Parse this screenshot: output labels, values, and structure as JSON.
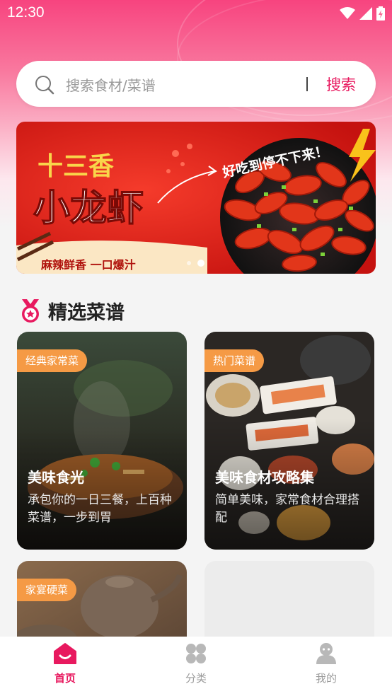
{
  "status_bar": {
    "time": "12:30"
  },
  "search": {
    "placeholder": "搜索食材/菜谱",
    "button_label": "搜索"
  },
  "banner": {
    "title_line1": "十三香",
    "title_line2": "小龙虾",
    "slogan": "好吃到停不下来！",
    "subtitle": "麻辣鲜香 一口爆汁",
    "active_dot": 2,
    "dot_count": 2
  },
  "section": {
    "title": "精选菜谱"
  },
  "cards": [
    {
      "tag": "经典家常菜",
      "title": "美味食光",
      "desc": "承包你的一日三餐，上百种菜谱，一步到胃"
    },
    {
      "tag": "热门菜谱",
      "title": "美味食材攻略集",
      "desc": "简单美味，家常食材合理搭配"
    },
    {
      "tag": "家宴硬菜",
      "title": "",
      "desc": ""
    }
  ],
  "nav": [
    {
      "label": "首页",
      "icon": "home-icon",
      "active": true
    },
    {
      "label": "分类",
      "icon": "category-icon",
      "active": false
    },
    {
      "label": "我的",
      "icon": "profile-icon",
      "active": false
    }
  ],
  "colors": {
    "accent": "#e8195f",
    "tag": "#f59a45",
    "inactive": "#9b9b9b"
  }
}
